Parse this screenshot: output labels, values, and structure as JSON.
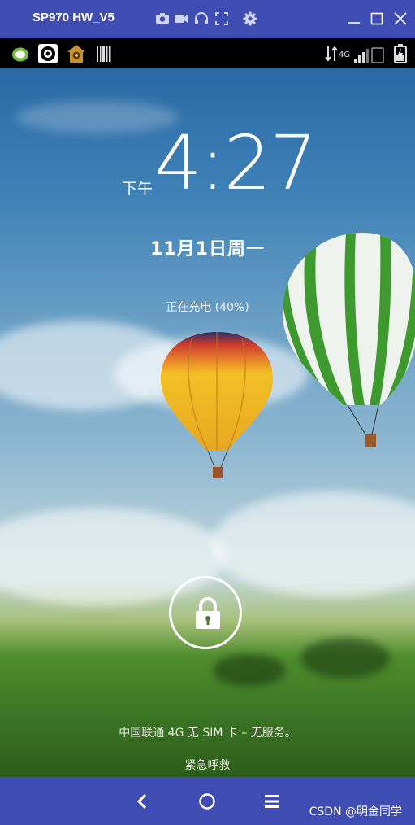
{
  "window": {
    "title": "SP970 HW_V5",
    "toolbar_icons": [
      "camera-icon",
      "video-icon",
      "headset-icon",
      "fullscreen-icon",
      "settings-icon"
    ],
    "controls": [
      "minimize-icon",
      "maximize-icon",
      "close-icon"
    ]
  },
  "status_bar": {
    "network_label": "4G",
    "left_icons": [
      "wechat-icon",
      "record-icon",
      "app-icon",
      "barcode-icon"
    ],
    "right_icons": [
      "data-transfer-icon",
      "signal-icon",
      "battery-icon"
    ]
  },
  "lockscreen": {
    "ampm": "下午",
    "time": "4:27",
    "date": "11月1日周一",
    "charging": "正在充电 (40%)",
    "carrier": "中国联通 4G   无 SIM 卡 – 无服务。",
    "emergency": "紧急呼救",
    "lock_icon": "lock-icon"
  },
  "nav_bar": {
    "buttons": [
      "back-icon",
      "home-icon",
      "menu-icon"
    ],
    "watermark": "CSDN @明金同学"
  },
  "colors": {
    "chrome": "#3f4db3",
    "statusbar": "#000000",
    "text": "#ffffff"
  }
}
